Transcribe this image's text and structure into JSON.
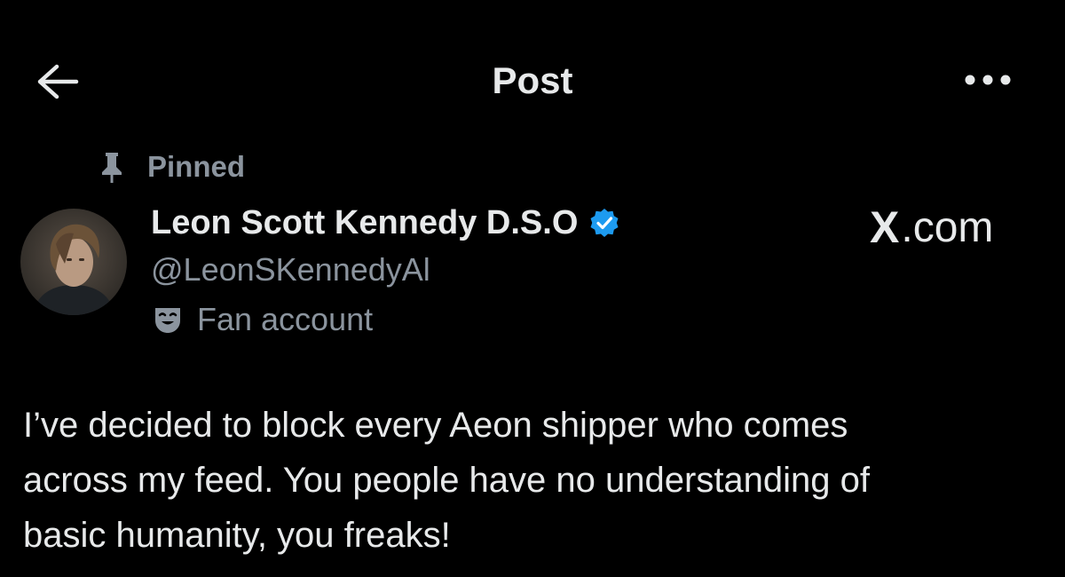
{
  "header": {
    "title": "Post",
    "back_icon": "arrow-left-icon",
    "more_icon": "more-horizontal-icon"
  },
  "pinned": {
    "label": "Pinned",
    "icon": "pin-icon"
  },
  "author": {
    "display_name": "Leon Scott Kennedy D.S.O",
    "handle": "@LeonSKennedyAl",
    "verified_icon": "verified-badge-icon",
    "affiliation_icon": "theater-mask-icon",
    "affiliation_label": "Fan account",
    "avatar": "avatar"
  },
  "watermark": {
    "brand_mark": "X",
    "suffix": ".com"
  },
  "post": {
    "text": "I’ve decided to block every Aeon shipper who comes\nacross my feed. You people have no understanding of\nbasic humanity, you freaks!"
  },
  "colors": {
    "background": "#000000",
    "primary_text": "#e7e9ea",
    "secondary_text": "#8b949e",
    "verified_blue": "#1d9bf0"
  }
}
